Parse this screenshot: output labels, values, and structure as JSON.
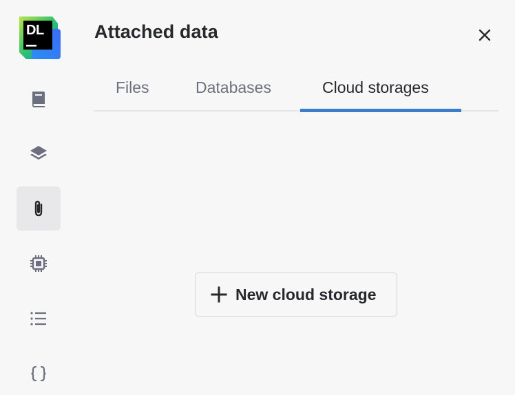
{
  "app": {
    "logo_text": "DL"
  },
  "sidebar": {
    "items": [
      {
        "icon": "book-icon",
        "active": false
      },
      {
        "icon": "layers-icon",
        "active": false
      },
      {
        "icon": "paperclip-icon",
        "active": true
      },
      {
        "icon": "chip-icon",
        "active": false
      },
      {
        "icon": "list-icon",
        "active": false
      },
      {
        "icon": "braces-icon",
        "active": false
      }
    ]
  },
  "panel": {
    "title": "Attached data",
    "close_icon": "close-icon",
    "tabs": [
      {
        "label": "Files",
        "active": false
      },
      {
        "label": "Databases",
        "active": false
      },
      {
        "label": "Cloud storages",
        "active": true
      }
    ],
    "new_button": {
      "icon": "plus-icon",
      "label": "New cloud storage"
    }
  },
  "colors": {
    "accent": "#3b7dc9",
    "background": "#f7f7f8",
    "active_rail_bg": "#e8e8ea",
    "text_primary": "#27282c",
    "text_muted": "#6c707e"
  }
}
